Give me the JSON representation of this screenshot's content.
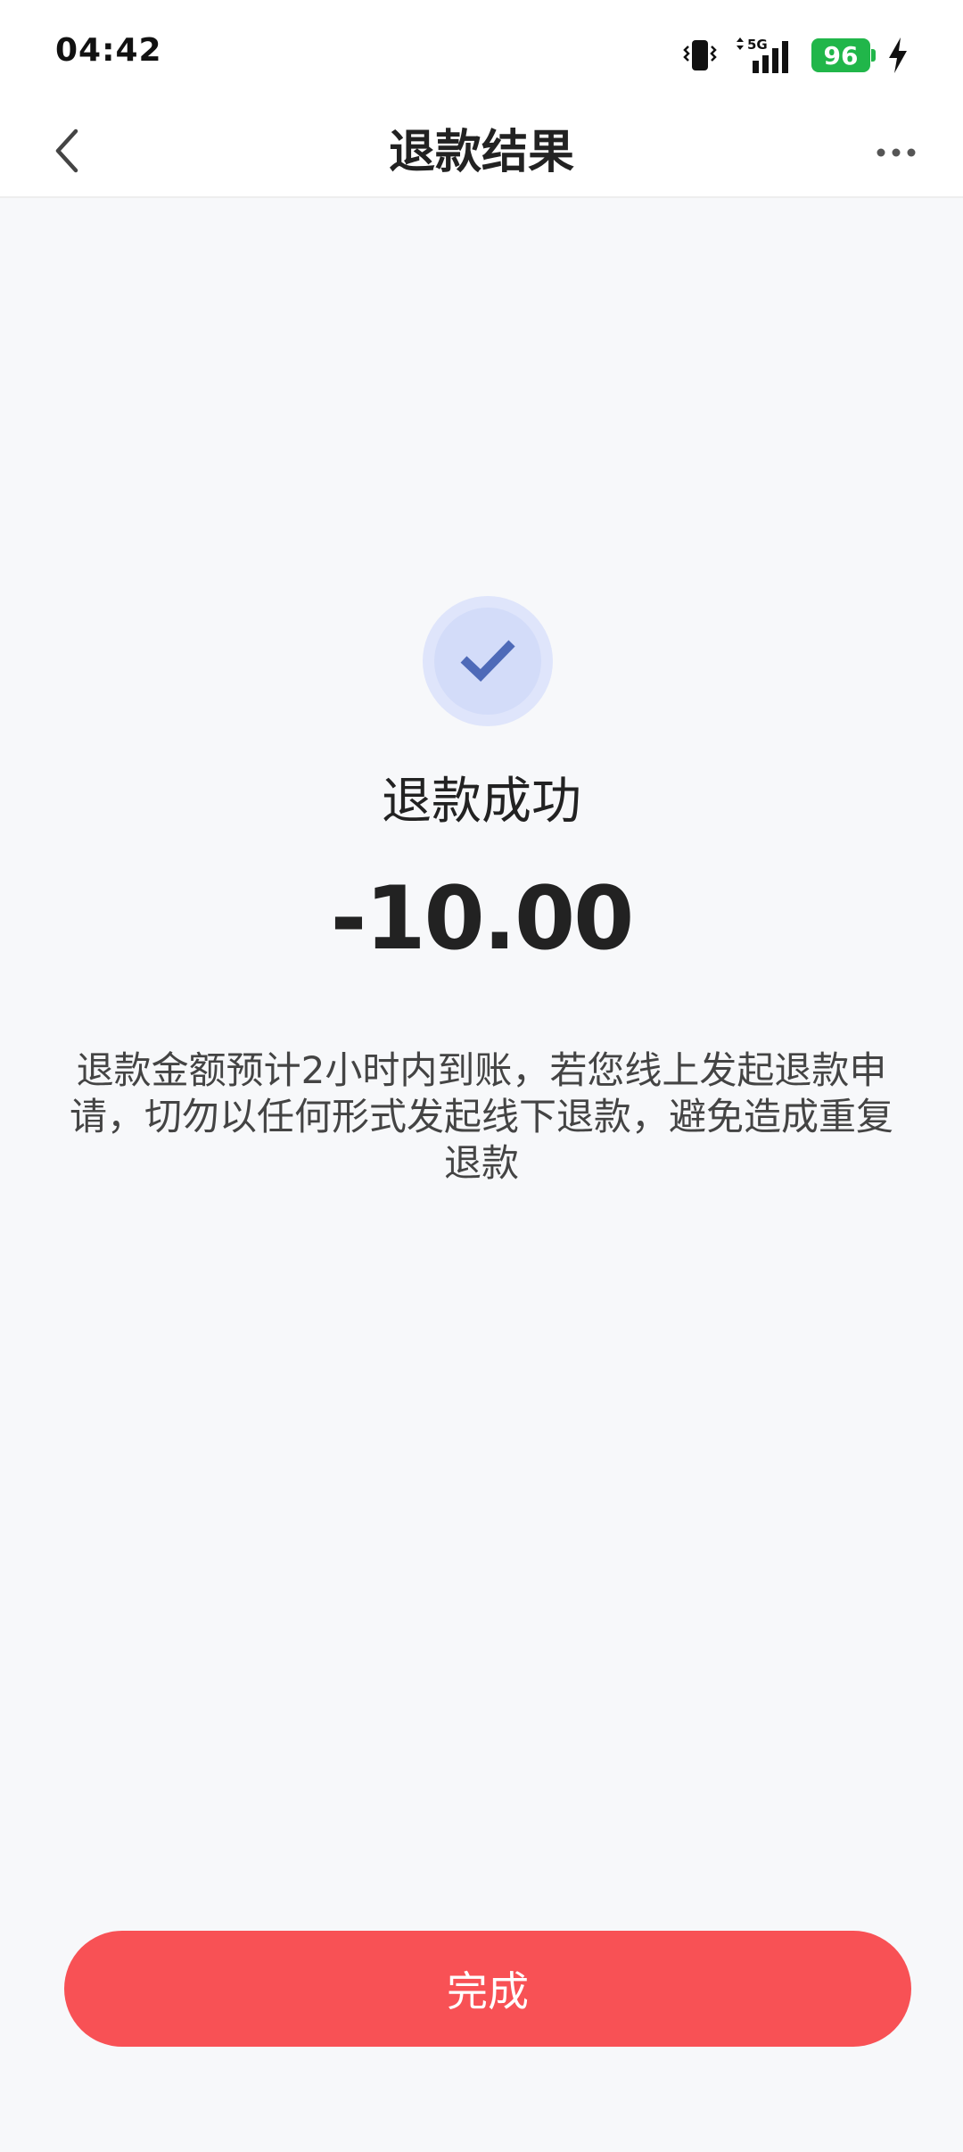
{
  "status_bar": {
    "time": "04:42",
    "network": "5G",
    "battery": "96",
    "icons": [
      "vibrate-icon",
      "signal-icon",
      "battery-icon",
      "charging-icon"
    ]
  },
  "nav": {
    "title": "退款结果",
    "back_icon": "chevron-left-icon",
    "more_icon": "more-dots-icon"
  },
  "result": {
    "icon": "check-icon",
    "title": "退款成功",
    "amount": "-10.00",
    "note": "退款金额预计2小时内到账，若您线上发起退款申请，切勿以任何形式发起线下退款，避免造成重复退款"
  },
  "done_button": {
    "label": "完成"
  },
  "colors": {
    "background": "#f7f8fa",
    "accent": "#f85155",
    "icon_circle": "#dfe5fb",
    "check": "#4e6ab8",
    "battery": "#21b64a"
  }
}
